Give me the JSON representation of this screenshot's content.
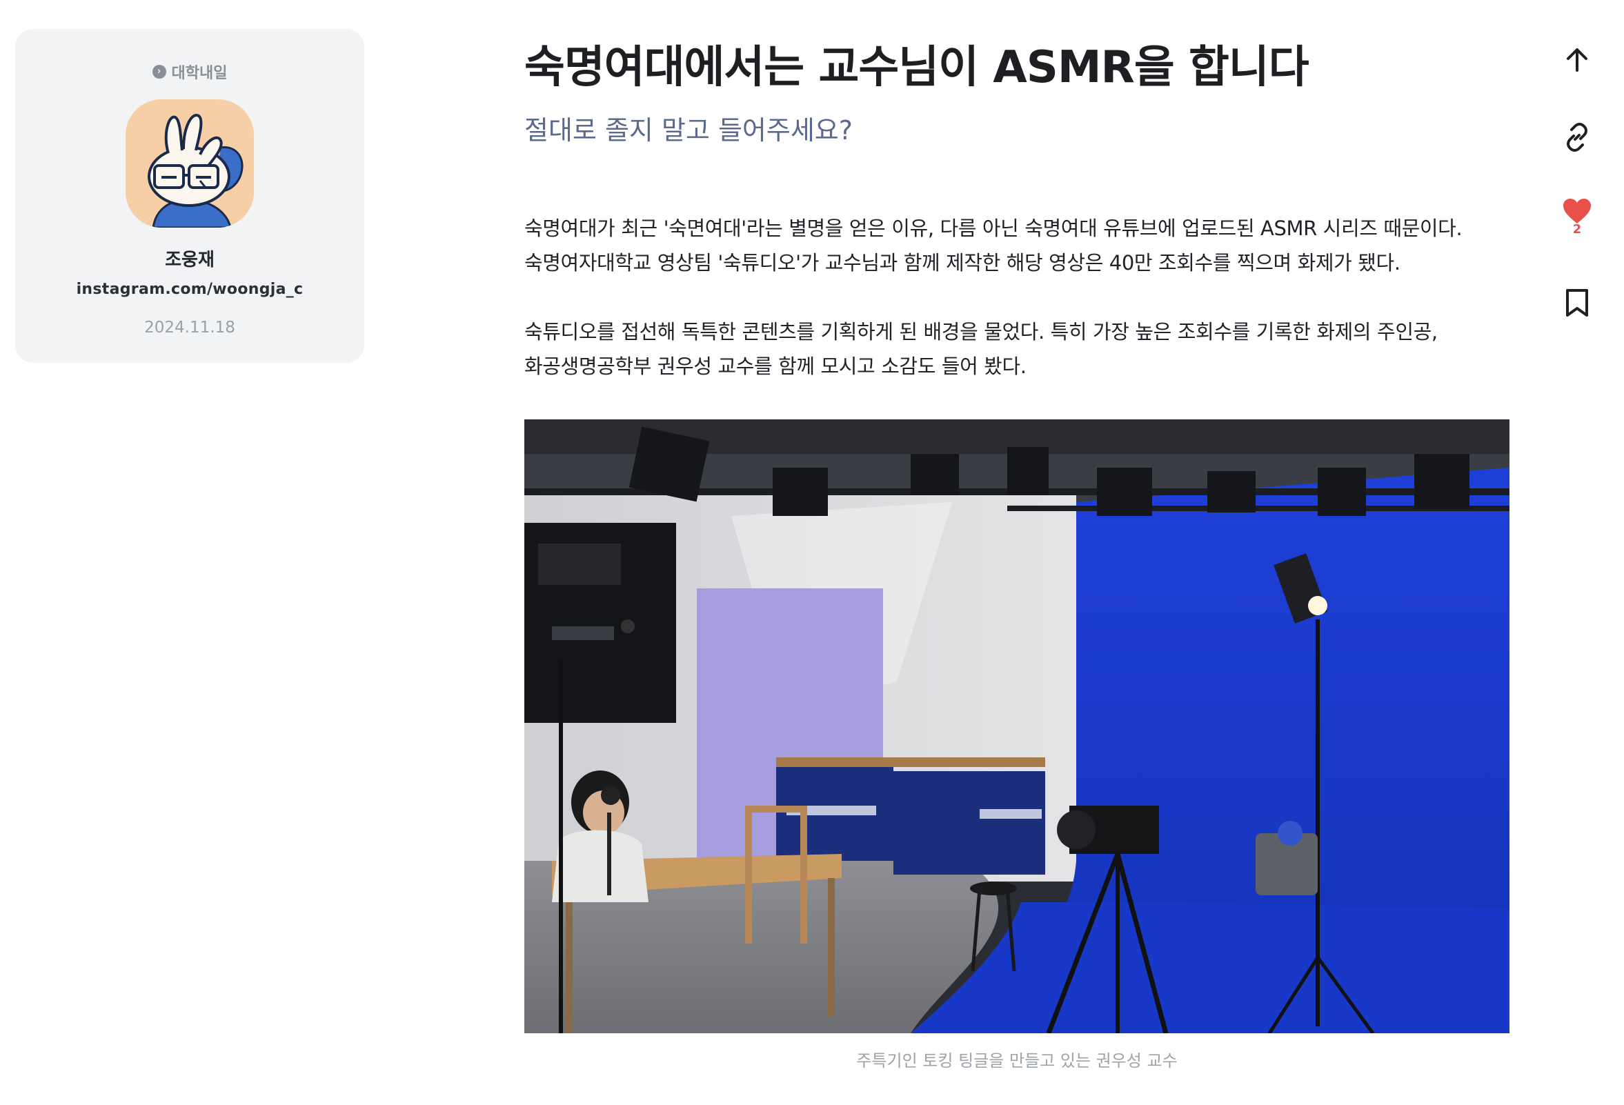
{
  "author": {
    "channel": "대학내일",
    "name": "조웅재",
    "link": "instagram.com/woongja_c",
    "date": "2024.11.18"
  },
  "article": {
    "title": "숙명여대에서는 교수님이 ASMR을 합니다",
    "subtitle": "절대로 졸지 말고 들어주세요?",
    "paragraphs": [
      [
        "숙명여대가 최근 '숙면여대'라는 별명을 얻은 이유, 다름 아닌 숙명여대 유튜브에 업로드된 ASMR 시리즈 때문이다.",
        "숙명여자대학교 영상팀 '숙튜디오'가 교수님과 함께 제작한 해당 영상은 40만 조회수를 찍으며 화제가 됐다."
      ],
      [
        "숙튜디오를 접선해 독특한 콘텐츠를 기획하게 된 배경을 물었다. 특히 가장 높은 조회수를 기록한 화제의 주인공,",
        "화공생명공학부 권우성 교수를 함께 모시고 소감도 들어 봤다."
      ]
    ],
    "image_caption": "주특기인 토킹 팅글을 만들고 있는 권우성 교수"
  },
  "actions": {
    "scroll_top_icon": "arrow-up-icon",
    "copy_link_icon": "link-icon",
    "like_icon": "heart-icon",
    "like_count": "2",
    "bookmark_icon": "bookmark-icon"
  },
  "colors": {
    "card_bg": "#f2f3f5",
    "subtitle": "#5a6a8c",
    "like": "#e8514a",
    "chroma_blue": "#1d3fd6"
  }
}
